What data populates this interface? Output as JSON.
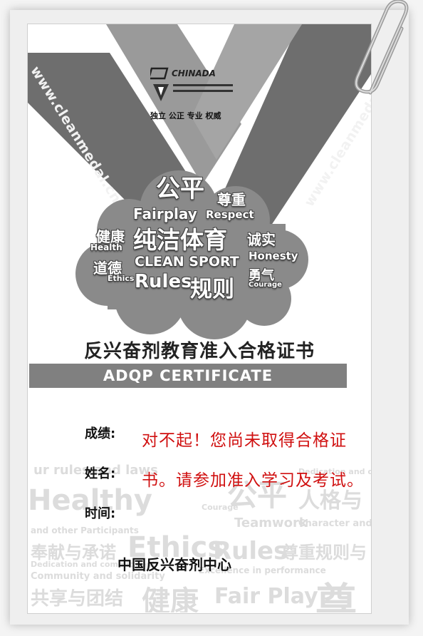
{
  "logo": {
    "name": "CHINADA",
    "tagline": "独立 公正 专业 权威"
  },
  "ribbon": {
    "left_url": "www.cleanmedal.cn",
    "right_url": "www.cleanmedal.cn"
  },
  "cloud_words": {
    "gongping": "公平",
    "zunzhong": "尊重",
    "fairplay": "Fairplay",
    "respect": "Respect",
    "jiankang": "健康",
    "health": "Health",
    "chunjie": "纯洁体育",
    "chengshi": "诚实",
    "daode": "道德",
    "ethics": "Ethics",
    "clean_sport": "CLEAN SPORT",
    "honesty": "Honesty",
    "yongqi": "勇气",
    "courage": "Courage",
    "rules": "Rules",
    "guize": "规则"
  },
  "certificate": {
    "title": "反兴奋剂教育准入合格证书",
    "banner": "ADQP  CERTIFICATE"
  },
  "fields": {
    "score_label": "成绩:",
    "name_label": "姓名:",
    "time_label": "时间:"
  },
  "message": "对不起！您尚未取得合格证书。请参加准入学习及考试。",
  "issuer": "中国反兴奋剂中心",
  "collage_words": {
    "a": "Healthy",
    "b": "公平",
    "c": "人格与",
    "d": "Teamwork",
    "e": "Ethics",
    "f": "Rules",
    "g": "尊重规则与",
    "h": "奉献与承诺",
    "i": "共享与团结",
    "j": "健康",
    "k": "Fair Play",
    "l": "尊",
    "m": "Courage",
    "n": "Character and",
    "o": "Community and solidarity",
    "p": "Excellence in performance",
    "q": "Dedication and commitment",
    "r": "ur rules and laws",
    "s": "and other Participants",
    "t": "Dedication and comm"
  },
  "colors": {
    "ribbon": "#6e6e6e",
    "banner": "#808080",
    "message": "#d01010"
  }
}
